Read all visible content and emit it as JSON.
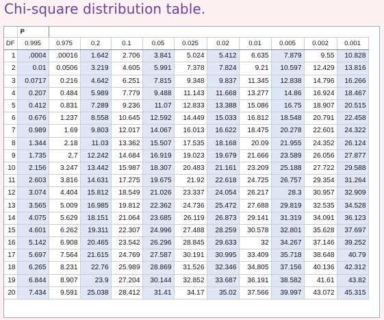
{
  "title": "Chi-square distribution table.",
  "table": {
    "p_label": "P",
    "df_label": "DF",
    "columns": [
      "0.995",
      "0.975",
      "0.2",
      "0.1",
      "0.05",
      "0.025",
      "0.02",
      "0.01",
      "0.005",
      "0.002",
      "0.001"
    ],
    "rows": [
      {
        "df": "1",
        "values": [
          ".0004",
          ".00016",
          "1.642",
          "2.706",
          "3.841",
          "5.024",
          "5.412",
          "6.635",
          "7.879",
          "9.55",
          "10.828"
        ]
      },
      {
        "df": "2",
        "values": [
          "0.01",
          "0.0506",
          "3.219",
          "4.605",
          "5.991",
          "7.378",
          "7.824",
          "9.21",
          "10.597",
          "12.429",
          "13.816"
        ]
      },
      {
        "df": "3",
        "values": [
          "0.0717",
          "0.216",
          "4.642",
          "6.251",
          "7.815",
          "9.348",
          "9.837",
          "11.345",
          "12.838",
          "14.796",
          "16.266"
        ]
      },
      {
        "df": "4",
        "values": [
          "0.207",
          "0.484",
          "5.989",
          "7.779",
          "9.488",
          "11.143",
          "11.668",
          "13.277",
          "14.86",
          "16.924",
          "18.467"
        ]
      },
      {
        "df": "5",
        "values": [
          "0.412",
          "0.831",
          "7.289",
          "9.236",
          "11.07",
          "12.833",
          "13.388",
          "15.086",
          "16.75",
          "18.907",
          "20.515"
        ]
      },
      {
        "df": "6",
        "values": [
          "0.676",
          "1.237",
          "8.558",
          "10.645",
          "12.592",
          "14.449",
          "15.033",
          "16.812",
          "18.548",
          "20.791",
          "22.458"
        ]
      },
      {
        "df": "7",
        "values": [
          "0.989",
          "1.69",
          "9.803",
          "12.017",
          "14.067",
          "16.013",
          "16.622",
          "18.475",
          "20.278",
          "22.601",
          "24.322"
        ]
      },
      {
        "df": "8",
        "values": [
          "1.344",
          "2.18",
          "11.03",
          "13.362",
          "15.507",
          "17.535",
          "18.168",
          "20.09",
          "21.955",
          "24.352",
          "26.124"
        ]
      },
      {
        "df": "9",
        "values": [
          "1.735",
          "2.7",
          "12.242",
          "14.684",
          "16.919",
          "19.023",
          "19.679",
          "21.666",
          "23.589",
          "26.056",
          "27.877"
        ]
      },
      {
        "df": "10",
        "values": [
          "2.156",
          "3.247",
          "13.442",
          "15.987",
          "18.307",
          "20.483",
          "21.161",
          "23.209",
          "25.188",
          "27.722",
          "29.588"
        ]
      },
      {
        "df": "11",
        "values": [
          "2.603",
          "3.816",
          "14.631",
          "17.275",
          "19.675",
          "21.92",
          "22.618",
          "24.725",
          "26.757",
          "29.354",
          "31.264"
        ]
      },
      {
        "df": "12",
        "values": [
          "3.074",
          "4.404",
          "15.812",
          "18.549",
          "21.026",
          "23.337",
          "24.054",
          "26.217",
          "28.3",
          "30.957",
          "32.909"
        ]
      },
      {
        "df": "13",
        "values": [
          "3.565",
          "5.009",
          "16.985",
          "19.812",
          "22.362",
          "24.736",
          "25.472",
          "27.688",
          "29.819",
          "32.535",
          "34.528"
        ]
      },
      {
        "df": "14",
        "values": [
          "4.075",
          "5.629",
          "18.151",
          "21.064",
          "23.685",
          "26.119",
          "26.873",
          "29.141",
          "31.319",
          "34.091",
          "36.123"
        ]
      },
      {
        "df": "15",
        "values": [
          "4.601",
          "6.262",
          "19.311",
          "22.307",
          "24.996",
          "27.488",
          "28.259",
          "30.578",
          "32.801",
          "35.628",
          "37.697"
        ]
      },
      {
        "df": "16",
        "values": [
          "5.142",
          "6.908",
          "20.465",
          "23.542",
          "26.296",
          "28.845",
          "29.633",
          "32",
          "34.267",
          "37.146",
          "39.252"
        ]
      },
      {
        "df": "17",
        "values": [
          "5.697",
          "7.564",
          "21.615",
          "24.769",
          "27.587",
          "30.191",
          "30.995",
          "33.409",
          "35.718",
          "38.648",
          "40.79"
        ]
      },
      {
        "df": "18",
        "values": [
          "6.265",
          "8.231",
          "22.76",
          "25.989",
          "28.869",
          "31.526",
          "32.346",
          "34.805",
          "37.156",
          "40.136",
          "42.312"
        ]
      },
      {
        "df": "19",
        "values": [
          "6.844",
          "8.907",
          "23.9",
          "27.204",
          "30.144",
          "32.852",
          "33.687",
          "36.191",
          "38.582",
          "41.61",
          "43.82"
        ]
      },
      {
        "df": "20",
        "values": [
          "7.434",
          "9.591",
          "25.038",
          "28.412",
          "31.41",
          "34.17",
          "35.02",
          "37.566",
          "39.997",
          "43.072",
          "45.315"
        ]
      }
    ]
  }
}
